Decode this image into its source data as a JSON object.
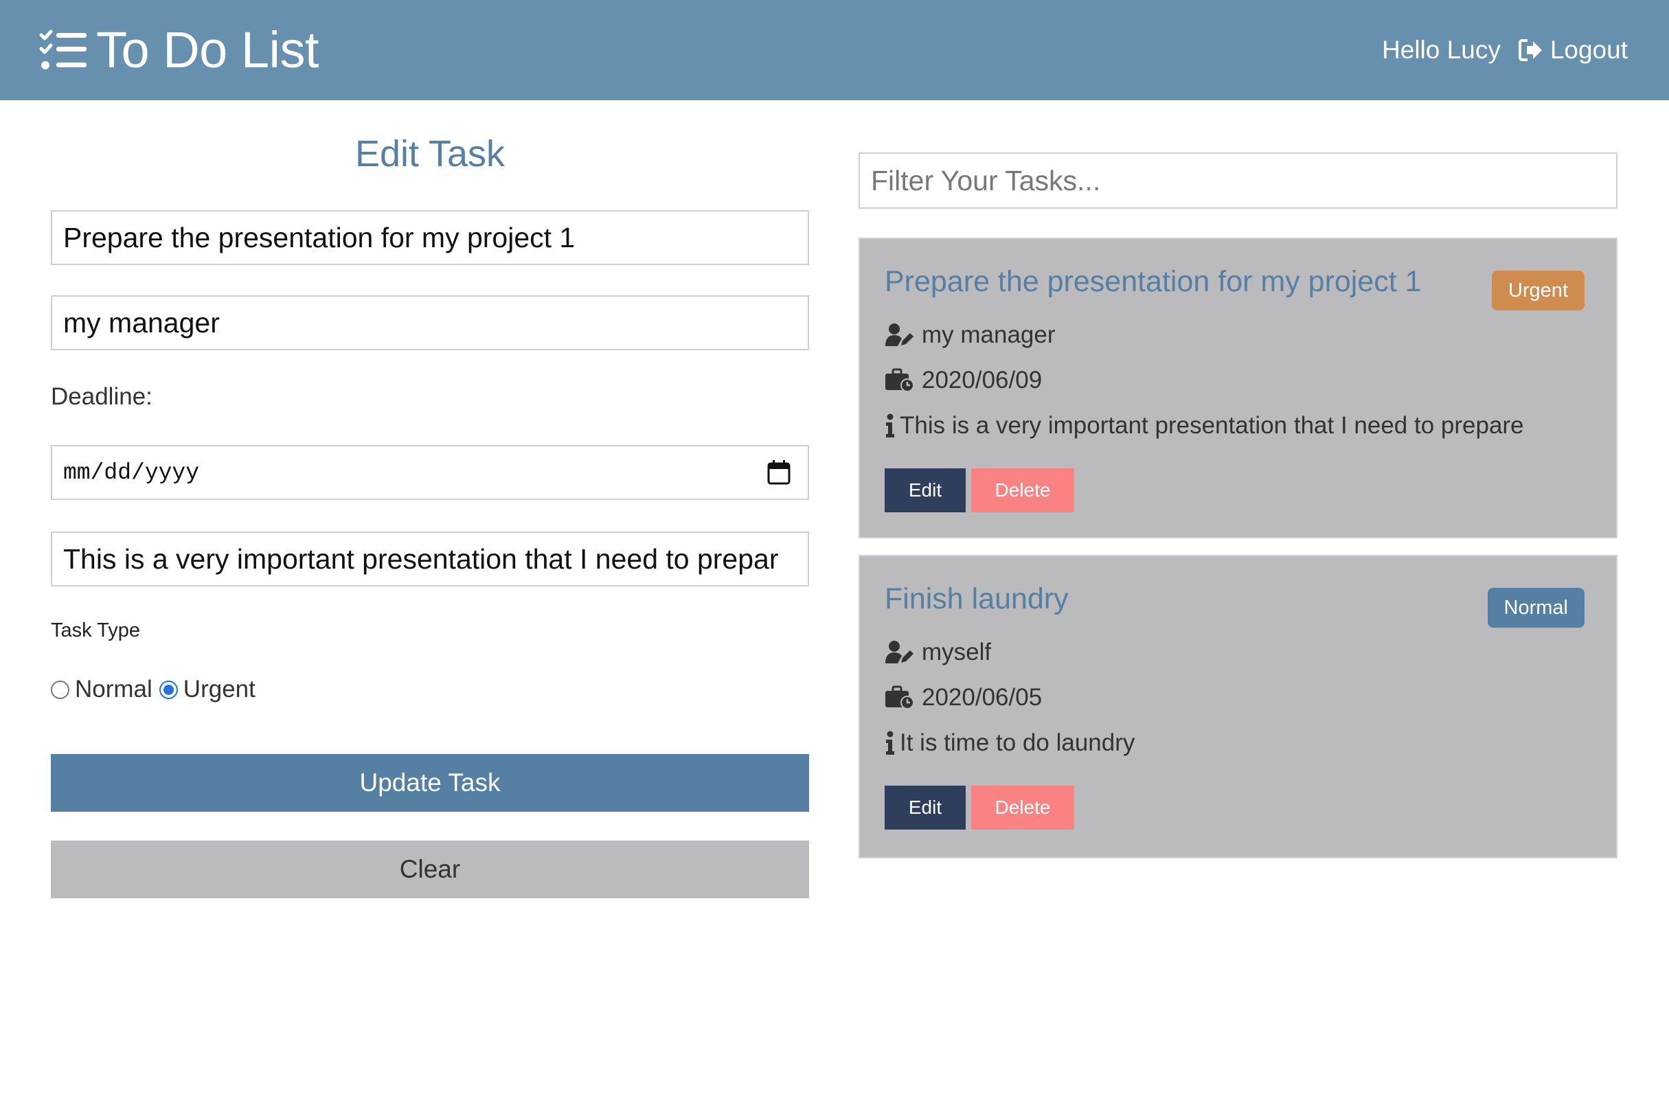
{
  "header": {
    "title": "To Do List",
    "greeting": "Hello Lucy",
    "logout_label": "Logout"
  },
  "form": {
    "title": "Edit Task",
    "task_name_value": "Prepare the presentation for my project 1",
    "assignee_value": "my manager",
    "deadline_label": "Deadline:",
    "deadline_placeholder": "mm/dd/yyyy",
    "description_value": "This is a very important presentation that I need to prepar",
    "task_type_label": "Task Type",
    "type_options": [
      {
        "label": "Normal",
        "checked": false
      },
      {
        "label": "Urgent",
        "checked": true
      }
    ],
    "update_label": "Update Task",
    "clear_label": "Clear"
  },
  "filter": {
    "placeholder": "Filter Your Tasks..."
  },
  "tasks": [
    {
      "title": "Prepare the presentation for my project 1",
      "badge": "Urgent",
      "badge_color": "#d08c4f",
      "assignee": "my manager",
      "deadline": "2020/06/09",
      "description": "This is a very important presentation that I need to prepare",
      "edit_label": "Edit",
      "delete_label": "Delete"
    },
    {
      "title": "Finish laundry",
      "badge": "Normal",
      "badge_color": "#5680a3",
      "assignee": "myself",
      "deadline": "2020/06/05",
      "description": "It is time to do laundry",
      "edit_label": "Edit",
      "delete_label": "Delete"
    }
  ],
  "colors": {
    "header": "#678fae",
    "primary": "#5680a3",
    "urgent": "#d08c4f",
    "edit_button": "#2f3e5c",
    "delete_button": "#f98282",
    "card_bg": "#bbbbbe"
  },
  "icons": {
    "brand": "checklist-icon",
    "logout": "sign-out-icon",
    "calendar": "calendar-icon",
    "assignee": "user-edit-icon",
    "deadline": "briefcase-clock-icon",
    "description": "info-icon"
  }
}
